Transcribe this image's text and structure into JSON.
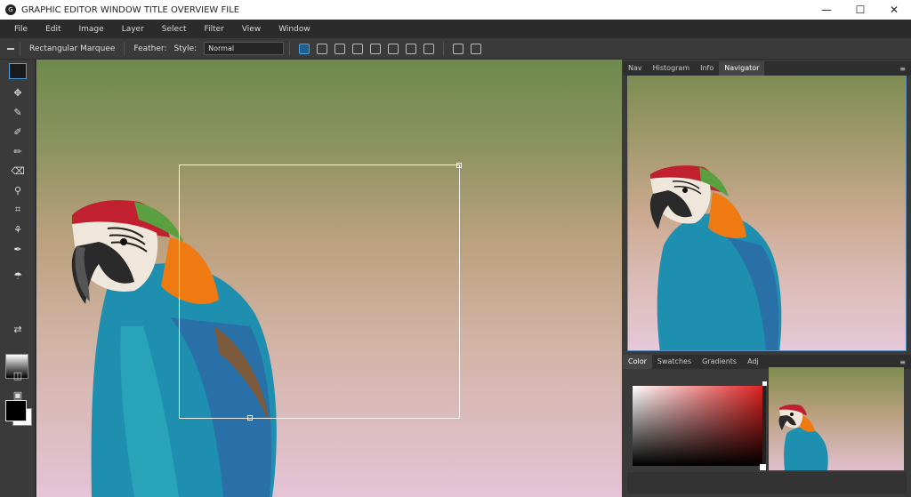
{
  "window": {
    "title": "GRAPHIC EDITOR WINDOW TITLE OVERVIEW FILE",
    "logo_glyph": "G",
    "minimize_glyph": "—",
    "maximize_glyph": "☐",
    "close_glyph": "✕"
  },
  "menu": {
    "items": [
      "File",
      "Edit",
      "Image",
      "Layer",
      "Select",
      "Filter",
      "View",
      "Window"
    ]
  },
  "options": {
    "back_glyph": "◂",
    "tool_preset": "Rectangular Marquee",
    "feather_label": "Feather:",
    "style_label": "Style:",
    "style_value": "Normal",
    "icons": [
      "new-selection-icon",
      "add-selection-icon",
      "subtract-selection-icon",
      "intersect-selection-icon",
      "align-left-icon",
      "align-center-icon",
      "align-right-icon",
      "distribute-icon",
      "grid-icon",
      "layers-icon"
    ]
  },
  "tools": [
    {
      "name": "foreground-color-tool",
      "glyph": ""
    },
    {
      "name": "move-tool-icon",
      "glyph": "✥"
    },
    {
      "name": "lasso-tool-icon",
      "glyph": "✎"
    },
    {
      "name": "brush-tool-icon",
      "glyph": "✐"
    },
    {
      "name": "pencil-tool-icon",
      "glyph": "✏"
    },
    {
      "name": "eraser-tool-icon",
      "glyph": "⌫"
    },
    {
      "name": "stamp-tool-icon",
      "glyph": "⚲"
    },
    {
      "name": "crop-tool-icon",
      "glyph": "⌗"
    },
    {
      "name": "dodge-tool-icon",
      "glyph": "⚘"
    },
    {
      "name": "pen-tool-icon",
      "glyph": "✒"
    },
    {
      "name": "smudge-tool-icon",
      "glyph": "☂"
    }
  ],
  "panels": {
    "navigator_tabs": [
      "Nav",
      "Histogram",
      "Info",
      "Navigator"
    ],
    "navigator_active_index": 3,
    "color_tabs": [
      "Color",
      "Swatches",
      "Gradients"
    ],
    "color_extra_tab": "Adj",
    "menu_glyph": "≡"
  },
  "colors": {
    "accent": "#4aa0e0",
    "foreground": "#000000",
    "background": "#ffffff",
    "picker_hue": "#e02020"
  }
}
